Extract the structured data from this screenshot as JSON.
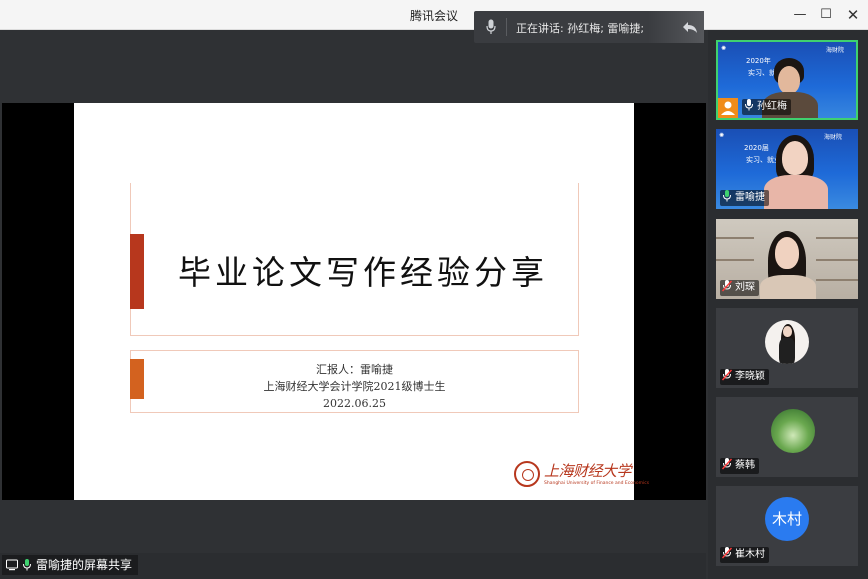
{
  "window": {
    "title": "腾讯会议",
    "min_glyph": "—",
    "max_glyph": "☐",
    "close_glyph": "✕"
  },
  "speaking": {
    "text": "正在讲话: 孙红梅; 雷喻捷;"
  },
  "slide": {
    "title": "毕业论文写作经验分享",
    "reporter": "汇报人：雷喻捷",
    "affiliation": "上海财经大学会计学院2021级博士生",
    "date": "2022.06.25",
    "logo_text": "上海财经大学",
    "logo_en": "Shanghai University of Finance and Economics"
  },
  "participants": [
    {
      "name": "孙红梅",
      "mic": "on",
      "active": true,
      "banner_top": "2020年",
      "banner_mid": "实习、就业",
      "banner_corner": "海财院"
    },
    {
      "name": "雷喻捷",
      "mic": "on",
      "active": false,
      "banner_top": "2020届",
      "banner_mid": "实习、就业",
      "banner_corner": "海财院"
    },
    {
      "name": "刘琛",
      "mic": "muted",
      "active": false
    },
    {
      "name": "李晓颖",
      "mic": "muted",
      "active": false
    },
    {
      "name": "蔡韩",
      "mic": "muted",
      "active": false
    },
    {
      "name": "崔木村",
      "mic": "muted",
      "active": false,
      "avatar_text": "木村"
    }
  ],
  "screen_share": {
    "label": "雷喻捷的屏幕共享"
  },
  "colors": {
    "active_border": "#3fd16f",
    "accent_red": "#b7371d",
    "accent_orange": "#d3621f",
    "avatar_blue": "#2a7bf0"
  }
}
